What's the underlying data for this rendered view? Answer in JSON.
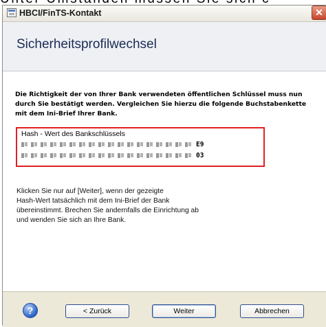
{
  "background_text": "Unter Umständen müssen Sie sich c",
  "window": {
    "title": "HBCI/FinTS-Kontakt",
    "close_symbol": "✕"
  },
  "header": {
    "title": "Sicherheitsprofilwechsel"
  },
  "content": {
    "intro": "Die Richtigkeit der von Ihrer Bank verwendeten öffentlichen Schlüssel muss nun durch Sie bestätigt werden. Vergleichen Sie hierzu die folgende Buchstabenkette mit dem Ini-Brief Ihrer Bank.",
    "hash": {
      "label": "Hash - Wert des Bankschlüssels",
      "line1_end": "E9",
      "line2_end": "03"
    },
    "instructions_lines": [
      "Klicken Sie nur auf [Weiter], wenn der gezeigte",
      "Hash-Wert tatsächlich mit dem Ini-Brief der Bank",
      "übereinstimmt. Brechen Sie andernfalls die Einrichtung ab",
      "und wenden Sie sich an Ihre Bank."
    ]
  },
  "footer": {
    "help_symbol": "?",
    "back_label": "< Zurück",
    "next_label": "Weiter",
    "cancel_label": "Abbrechen"
  }
}
